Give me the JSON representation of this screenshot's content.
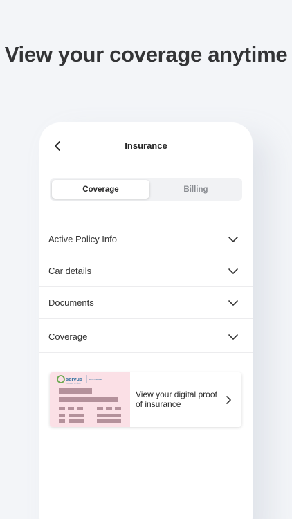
{
  "headline": "View your coverage anytime",
  "nav": {
    "back_icon": "chevron-left-icon",
    "title": "Insurance"
  },
  "tabs": [
    {
      "label": "Coverage",
      "active": true
    },
    {
      "label": "Billing",
      "active": false
    }
  ],
  "accordion": [
    {
      "label": "Active Policy Info",
      "icon": "chevron-down-icon"
    },
    {
      "label": "Car details",
      "icon": "chevron-down-icon"
    },
    {
      "label": "Documents",
      "icon": "chevron-down-icon"
    },
    {
      "label": "Coverage",
      "icon": "chevron-down-icon"
    }
  ],
  "proof_card": {
    "brand": "servus",
    "brand_sub": "insurance services",
    "brand_tag": "home and auto",
    "text": "View your digital proof of insurance",
    "icon": "chevron-right-icon"
  },
  "colors": {
    "background": "#f3f5f8",
    "card_thumb": "#fbe0e6",
    "brand_green": "#6aa84f",
    "brand_blue": "#2e6f9e"
  }
}
